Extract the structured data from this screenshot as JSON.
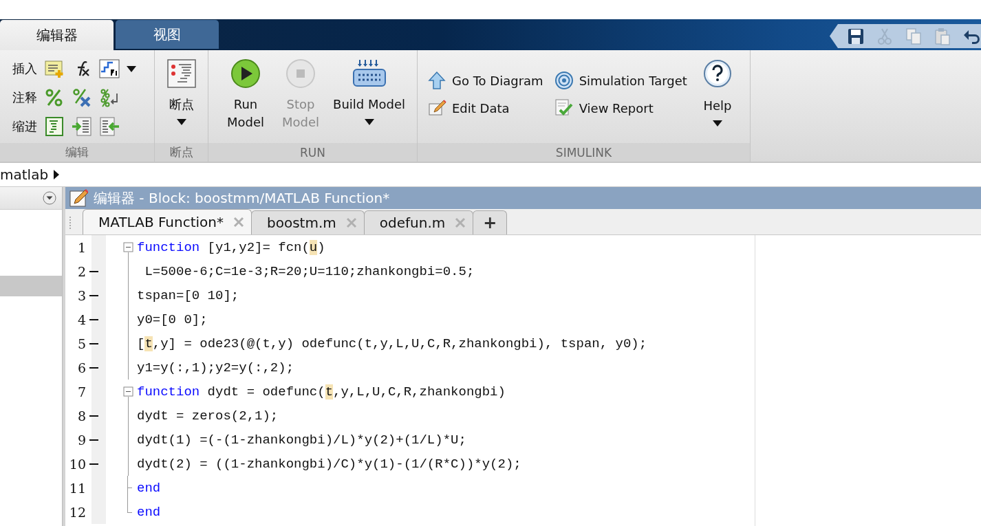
{
  "toolstrip_tabs": [
    {
      "label": "编辑器",
      "selected": true
    },
    {
      "label": "视图",
      "selected": false
    }
  ],
  "quick_access": [
    {
      "kind": "save",
      "disabled": false
    },
    {
      "kind": "cut",
      "disabled": true
    },
    {
      "kind": "copy",
      "disabled": true
    },
    {
      "kind": "paste",
      "disabled": true
    },
    {
      "kind": "undo",
      "disabled": false
    }
  ],
  "ribbon": {
    "edit_section": {
      "rows": [
        {
          "label": "插入"
        },
        {
          "label": "注释"
        },
        {
          "label": "缩进"
        }
      ],
      "title": "编辑"
    },
    "breakpoints_section": {
      "button": "断点",
      "title": "断点"
    },
    "run_section": {
      "buttons": [
        {
          "kind": "run",
          "label": "Run Model",
          "disabled": false
        },
        {
          "kind": "stop",
          "label": "Stop Model",
          "disabled": true
        },
        {
          "kind": "build",
          "label": "Build Model",
          "disabled": false
        }
      ],
      "title": "RUN"
    },
    "simulink_section": {
      "items": [
        {
          "kind": "diagram",
          "label": "Go To Diagram"
        },
        {
          "kind": "edit",
          "label": "Edit Data"
        },
        {
          "kind": "target",
          "label": "Simulation Target"
        },
        {
          "kind": "report",
          "label": "View Report"
        }
      ],
      "help": "Help",
      "title": "SIMULINK"
    }
  },
  "address_bar": {
    "path": "matlab"
  },
  "editor": {
    "title": "编辑器 - Block: boostmm/MATLAB Function*",
    "tabs": [
      {
        "label": "MATLAB Function*",
        "selected": true
      },
      {
        "label": "boostm.m",
        "selected": false
      },
      {
        "label": "odefun.m",
        "selected": false
      }
    ],
    "new_tab": "+",
    "lines": [
      {
        "number": "1",
        "executable": false,
        "kind": "fold_start",
        "segments": [
          {
            "kind": "keyword",
            "text": "function"
          },
          {
            "kind": "plain",
            "text": " [y1,y2]= fcn("
          },
          {
            "kind": "match",
            "text": "u"
          },
          {
            "kind": "plain",
            "text": ")"
          }
        ]
      },
      {
        "number": "2",
        "executable": true,
        "kind": "fold_body",
        "segments": [
          {
            "kind": "plain",
            "text": " L=500e-6;C=1e-3;R=20;U=110;zhankongbi=0.5;"
          }
        ]
      },
      {
        "number": "3",
        "executable": true,
        "kind": "fold_body",
        "segments": [
          {
            "kind": "plain",
            "text": "tspan=[0 10];"
          }
        ]
      },
      {
        "number": "4",
        "executable": true,
        "kind": "fold_body",
        "segments": [
          {
            "kind": "plain",
            "text": "y0=[0 0];"
          }
        ]
      },
      {
        "number": "5",
        "executable": true,
        "kind": "fold_body",
        "segments": [
          {
            "kind": "plain",
            "text": "["
          },
          {
            "kind": "match",
            "text": "t"
          },
          {
            "kind": "plain",
            "text": ",y] = ode23(@(t,y) odefunc(t,y,L,U,C,R,zhankongbi), tspan, y0);"
          }
        ]
      },
      {
        "number": "6",
        "executable": true,
        "kind": "fold_body",
        "segments": [
          {
            "kind": "plain",
            "text": "y1=y(:,1);y2=y(:,2);"
          }
        ]
      },
      {
        "number": "7",
        "executable": false,
        "kind": "fold_start",
        "segments": [
          {
            "kind": "keyword",
            "text": "function"
          },
          {
            "kind": "plain",
            "text": " dydt = odefunc("
          },
          {
            "kind": "match",
            "text": "t"
          },
          {
            "kind": "plain",
            "text": ",y,L,U,C,R,zhankongbi)"
          }
        ]
      },
      {
        "number": "8",
        "executable": true,
        "kind": "fold_body",
        "segments": [
          {
            "kind": "plain",
            "text": "dydt = zeros(2,1);"
          }
        ]
      },
      {
        "number": "9",
        "executable": true,
        "kind": "fold_body",
        "segments": [
          {
            "kind": "plain",
            "text": "dydt(1) =(-(1-zhankongbi)/L)*y(2)+(1/L)*U;"
          }
        ]
      },
      {
        "number": "10",
        "executable": true,
        "kind": "fold_body",
        "segments": [
          {
            "kind": "plain",
            "text": "dydt(2) = ((1-zhankongbi)/C)*y(1)-(1/(R*C))*y(2);"
          }
        ]
      },
      {
        "number": "11",
        "executable": false,
        "kind": "fold_inner_end",
        "segments": [
          {
            "kind": "keyword",
            "text": "end"
          }
        ]
      },
      {
        "number": "12",
        "executable": false,
        "kind": "fold_end",
        "segments": [
          {
            "kind": "keyword",
            "text": "end"
          }
        ]
      }
    ]
  }
}
